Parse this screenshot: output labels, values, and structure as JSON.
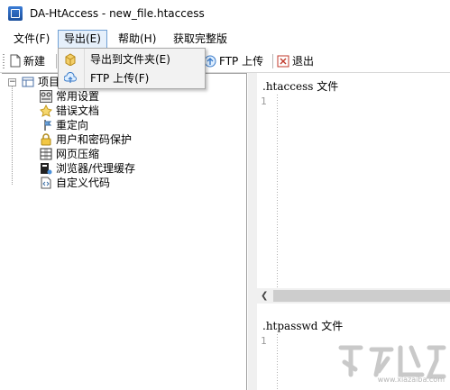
{
  "window": {
    "title": "DA-HtAccess - new_file.htaccess"
  },
  "menubar": {
    "file": "文件(F)",
    "export": "导出(E)",
    "help": "帮助(H)",
    "get_full": "获取完整版"
  },
  "toolbar": {
    "new": "新建",
    "ftp_upload": "FTP 上传",
    "exit": "退出"
  },
  "export_menu": {
    "items": [
      {
        "label": "导出到文件夹(E)",
        "icon": "folder-box-icon"
      },
      {
        "label": "FTP 上传(F)",
        "icon": "cloud-upload-icon"
      }
    ]
  },
  "tree": {
    "root": "项目",
    "items": [
      {
        "label": "常用设置",
        "icon": "settings-icon"
      },
      {
        "label": "错误文档",
        "icon": "error-doc-icon"
      },
      {
        "label": "重定向",
        "icon": "redirect-icon"
      },
      {
        "label": "用户和密码保护",
        "icon": "lock-icon"
      },
      {
        "label": "网页压缩",
        "icon": "compress-icon"
      },
      {
        "label": "浏览器/代理缓存",
        "icon": "cache-icon"
      },
      {
        "label": "自定义代码",
        "icon": "code-doc-icon"
      }
    ]
  },
  "editor": {
    "htaccess_heading": ".htaccess 文件",
    "htaccess_line": "1",
    "htpasswd_heading": ".htpasswd 文件",
    "htpasswd_line": "1"
  },
  "watermark": {
    "text": "www.xiazaiba.com"
  },
  "colors": {
    "menu_highlight": "#e6f0fb",
    "menu_border": "#6f9fd4",
    "panel_border": "#a0a0a0"
  }
}
